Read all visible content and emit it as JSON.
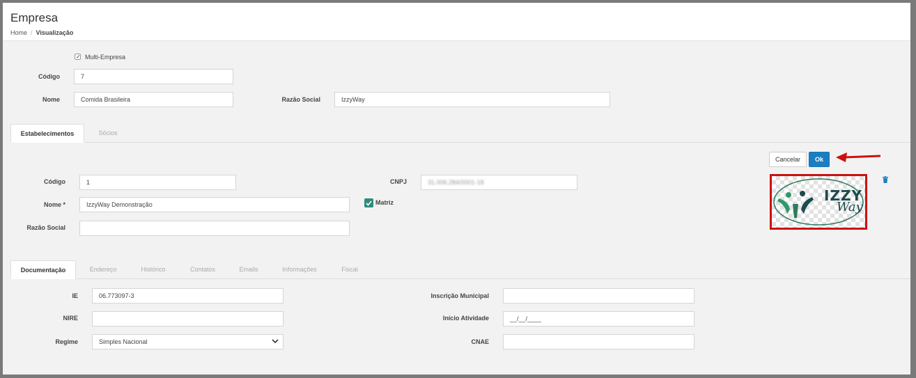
{
  "header": {
    "title": "Empresa",
    "breadcrumb": {
      "home": "Home",
      "separator": "/",
      "current": "Visualização"
    }
  },
  "company": {
    "multi_empresa_label": "Multi-Empresa",
    "multi_empresa_checked": true,
    "codigo_label": "Código",
    "codigo_value": "7",
    "nome_label": "Nome",
    "nome_value": "Comida Brasileira",
    "razao_social_label": "Razão Social",
    "razao_social_value": "IzzyWay"
  },
  "main_tabs": [
    {
      "label": "Estabelecimentos",
      "active": true
    },
    {
      "label": "Sócios",
      "active": false
    }
  ],
  "actions": {
    "cancel_label": "Cancelar",
    "ok_label": "Ok"
  },
  "establishment": {
    "codigo_label": "Código",
    "codigo_value": "1",
    "cnpj_label": "CNPJ",
    "cnpj_value": "31.006.284/0001-18",
    "nome_label": "Nome *",
    "nome_value": "IzzyWay Demonstração",
    "matriz_label": "Matriz",
    "matriz_checked": true,
    "razao_social_label": "Razão Social",
    "razao_social_value": ""
  },
  "logo": {
    "text_top": "IZZY",
    "text_bottom": "Way"
  },
  "sub_tabs": [
    {
      "label": "Documentação",
      "active": true
    },
    {
      "label": "Endereço",
      "active": false
    },
    {
      "label": "Histórico",
      "active": false
    },
    {
      "label": "Contatos",
      "active": false
    },
    {
      "label": "Emails",
      "active": false
    },
    {
      "label": "Informações",
      "active": false
    },
    {
      "label": "Fiscal",
      "active": false
    }
  ],
  "documentation": {
    "ie_label": "IE",
    "ie_value": "06.773097-3",
    "nire_label": "NIRE",
    "nire_value": "",
    "regime_label": "Regime",
    "regime_value": "Simples Nacional",
    "inscricao_municipal_label": "Inscrição Municipal",
    "inscricao_municipal_value": "",
    "inicio_atividade_label": "Início Atividade",
    "inicio_atividade_value": "__/__/____",
    "cnae_label": "CNAE",
    "cnae_value": ""
  },
  "icons": {
    "checkbox": "check-icon",
    "delete": "trash-icon",
    "select": "chevron-down-icon",
    "annotation": "red-arrow-icon"
  },
  "colors": {
    "primary_button": "#1b7ec2",
    "matriz_check": "#2e8b7a",
    "annotation_red": "#cc1111",
    "page_background": "#f2f2f2"
  }
}
